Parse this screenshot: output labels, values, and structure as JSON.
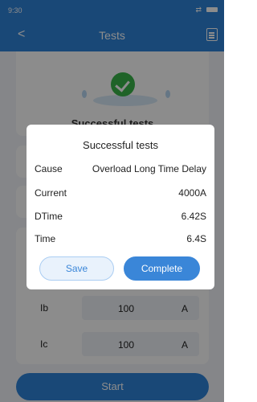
{
  "statusbar": {
    "time": "9:30"
  },
  "navbar": {
    "title": "Tests"
  },
  "hero": {
    "label": "Successful tests"
  },
  "rows": [
    {
      "label": "Ib",
      "value": "100",
      "unit": "A"
    },
    {
      "label": "Ic",
      "value": "100",
      "unit": "A"
    }
  ],
  "start_label": "Start",
  "dialog": {
    "title": "Successful tests",
    "items": [
      {
        "key": "Cause",
        "value": "Overload Long Time Delay"
      },
      {
        "key": "Current",
        "value": "4000A"
      },
      {
        "key": "DTime",
        "value": "6.42S"
      },
      {
        "key": "Time",
        "value": "6.4S"
      }
    ],
    "save_label": "Save",
    "complete_label": "Complete"
  },
  "colors": {
    "primary": "#2f83d9",
    "success": "#39b54a",
    "overlay": "rgba(0,0,0,0.45)"
  }
}
